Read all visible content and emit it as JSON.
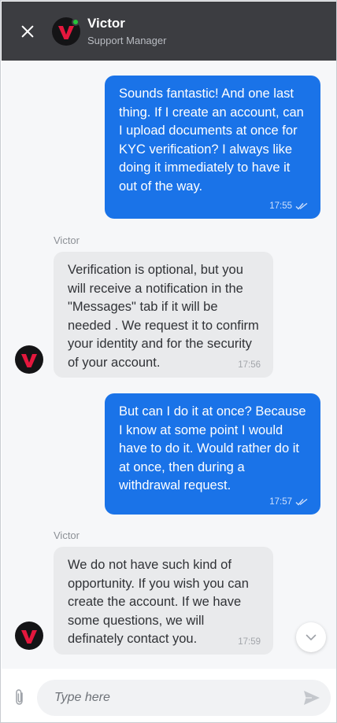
{
  "header": {
    "agent_name": "Victor",
    "agent_role": "Support Manager",
    "status": "online"
  },
  "messages": [
    {
      "direction": "outgoing",
      "text": "Sounds fantastic! And one last thing. If I create an account, can I upload documents at once for KYC verification? I always like doing it immediately to have it out of the way.",
      "time": "17:55",
      "read": true
    },
    {
      "direction": "incoming",
      "sender": "Victor",
      "text": "Verification is optional, but you will receive a notification in the \"Messages\" tab if it will be needed . We request it to confirm your identity and for the security of your account.",
      "time": "17:56"
    },
    {
      "direction": "outgoing",
      "text": "But can I do it at once? Because I know at some point I would have to do it. Would rather do it at once, then during a withdrawal request.",
      "time": "17:57",
      "read": true
    },
    {
      "direction": "incoming",
      "sender": "Victor",
      "text": "We do not have such kind of opportunity. If you wish you can create the account. If we have some questions, we will definately contact you.",
      "time": "17:59"
    }
  ],
  "composer": {
    "placeholder": "Type here",
    "value": ""
  },
  "colors": {
    "header_bg": "#3c3d41",
    "outgoing_bubble": "#1a73e8",
    "incoming_bubble": "#e9eaec",
    "online": "#27c43b",
    "brand_red": "#e4173d"
  },
  "icons": [
    "close-icon",
    "brand-logo-icon",
    "online-status-icon",
    "double-check-icon",
    "chevron-down-icon",
    "paperclip-icon",
    "send-icon"
  ]
}
